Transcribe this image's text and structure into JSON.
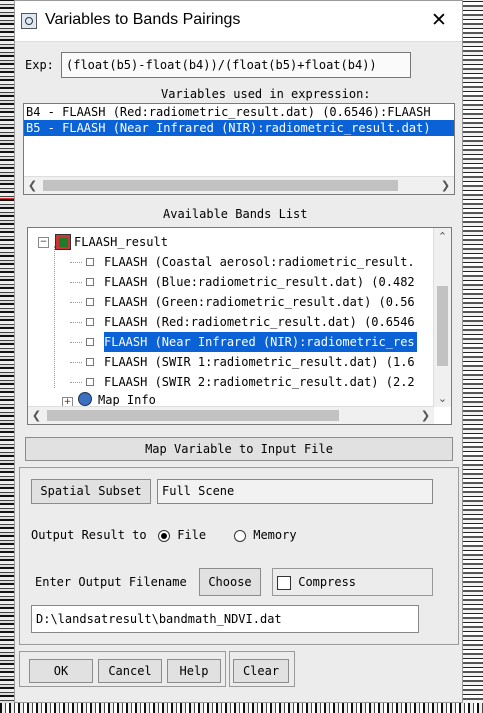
{
  "window": {
    "title": "Variables to Bands Pairings",
    "close_glyph": "✕"
  },
  "expression": {
    "label": "Exp:",
    "value": "(float(b5)-float(b4))/(float(b5)+float(b4))"
  },
  "variables": {
    "heading": "Variables used in expression:",
    "items": [
      {
        "text": "B4 - FLAASH (Red:radiometric_result.dat) (0.6546):FLAASH",
        "selected": false
      },
      {
        "text": "B5 - FLAASH (Near Infrared (NIR):radiometric_result.dat)",
        "selected": true
      }
    ]
  },
  "bands": {
    "heading": "Available Bands List",
    "root": "FLAASH_result",
    "items": [
      {
        "text": "FLAASH (Coastal aerosol:radiometric_result.",
        "selected": false
      },
      {
        "text": "FLAASH (Blue:radiometric_result.dat) (0.482",
        "selected": false
      },
      {
        "text": "FLAASH (Green:radiometric_result.dat) (0.56",
        "selected": false
      },
      {
        "text": "FLAASH (Red:radiometric_result.dat) (0.6546",
        "selected": false
      },
      {
        "text": "FLAASH (Near Infrared (NIR):radiometric_res",
        "selected": true
      },
      {
        "text": "FLAASH (SWIR 1:radiometric_result.dat) (1.6",
        "selected": false
      },
      {
        "text": "FLAASH (SWIR 2:radiometric_result.dat) (2.2",
        "selected": false
      }
    ],
    "map_info": "Map Info"
  },
  "map_button": "Map Variable to Input File",
  "spatial_subset": {
    "button": "Spatial Subset",
    "value": "Full Scene"
  },
  "output": {
    "label": "Output Result to",
    "file_label": "File",
    "memory_label": "Memory",
    "selected": "File"
  },
  "filename": {
    "label": "Enter Output Filename",
    "choose": "Choose",
    "compress": "Compress",
    "value": "D:\\landsatresult\\bandmath_NDVI.dat"
  },
  "footer": {
    "ok": "OK",
    "cancel": "Cancel",
    "help": "Help",
    "clear": "Clear"
  },
  "colors": {
    "selection": "#0a62d6",
    "dialog_bg": "#ececec"
  }
}
